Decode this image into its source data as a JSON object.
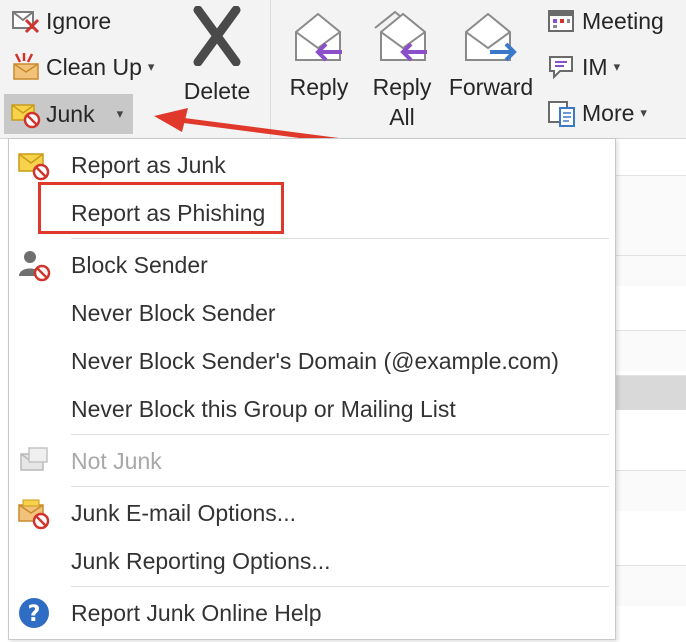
{
  "ribbon": {
    "ignore_label": "Ignore",
    "cleanup_label": "Clean Up",
    "junk_label": "Junk",
    "delete_label": "Delete",
    "reply_label": "Reply",
    "reply_all_line1": "Reply",
    "reply_all_line2": "All",
    "forward_label": "Forward",
    "meeting_label": "Meeting",
    "im_label": "IM",
    "more_label": "More"
  },
  "junk_menu": {
    "items": [
      {
        "label": "Report as Junk",
        "icon": "junk-mail-icon",
        "enabled": true
      },
      {
        "label": "Report as Phishing",
        "icon": null,
        "enabled": true
      },
      {
        "label": "Block Sender",
        "icon": "block-sender-icon",
        "enabled": true
      },
      {
        "label": "Never Block Sender",
        "icon": null,
        "enabled": true
      },
      {
        "label": "Never Block Sender's Domain (@example.com)",
        "icon": null,
        "enabled": true
      },
      {
        "label": "Never Block this Group or Mailing List",
        "icon": null,
        "enabled": true
      },
      {
        "label": "Not Junk",
        "icon": "not-junk-icon",
        "enabled": false
      },
      {
        "label": "Junk E-mail Options...",
        "icon": "junk-options-icon",
        "enabled": true
      },
      {
        "label": "Junk Reporting Options...",
        "icon": null,
        "enabled": true
      },
      {
        "label": "Report Junk Online Help",
        "icon": "help-icon",
        "enabled": true
      }
    ]
  },
  "colors": {
    "annotation_red": "#e0392b",
    "reply_purple": "#8a4fc9",
    "forward_blue": "#3a79c8",
    "delete_grey": "#4a4a4a"
  }
}
